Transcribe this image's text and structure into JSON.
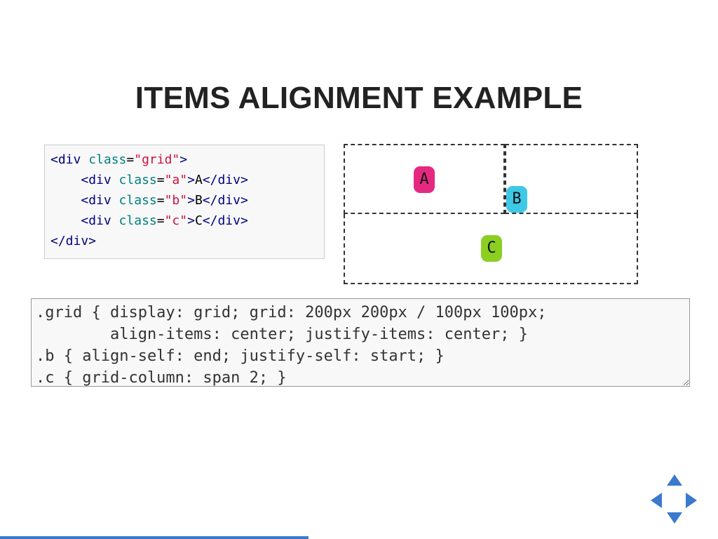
{
  "title": "ITEMS ALIGNMENT EXAMPLE",
  "html_code": {
    "l1": {
      "open": "<div",
      "attr": " class",
      "eq": "=",
      "val": "\"grid\"",
      "close": ">"
    },
    "l2": {
      "open": "<div",
      "attr": " class",
      "eq": "=",
      "val": "\"a\"",
      "close": ">",
      "text": "A",
      "endtag": "</div>"
    },
    "l3": {
      "open": "<div",
      "attr": " class",
      "eq": "=",
      "val": "\"b\"",
      "close": ">",
      "text": "B",
      "endtag": "</div>"
    },
    "l4": {
      "open": "<div",
      "attr": " class",
      "eq": "=",
      "val": "\"c\"",
      "close": ">",
      "text": "C",
      "endtag": "</div>"
    },
    "l5": {
      "endtag": "</div>"
    }
  },
  "demo": {
    "a": "A",
    "b": "B",
    "c": "C"
  },
  "css_code": ".grid { display: grid; grid: 200px 200px / 100px 100px;\n        align-items: center; justify-items: center; }\n.b { align-self: end; justify-self: start; }\n.c { grid-column: span 2; }"
}
